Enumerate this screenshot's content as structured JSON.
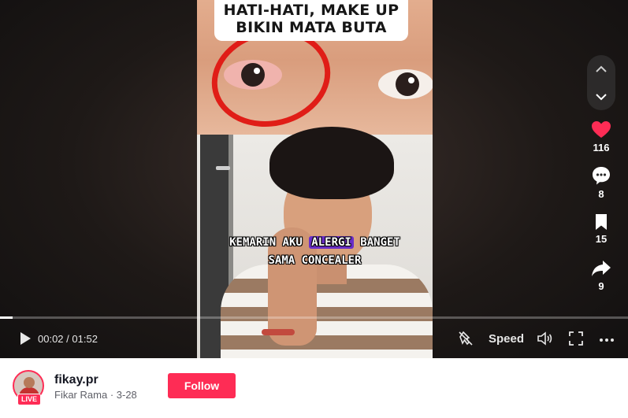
{
  "video": {
    "headline_line1": "HATI-HATI, MAKE UP",
    "headline_line2": "BIKIN MATA BUTA",
    "caption_pre": "KEMARIN AKU ",
    "caption_highlight": "ALERGI",
    "caption_post": " BANGET",
    "caption_line2": "SAMA CONCEALER"
  },
  "actions": {
    "likes": "116",
    "comments": "8",
    "saves": "15",
    "shares": "9"
  },
  "player": {
    "current_time": "00:02",
    "total_time": "01:52",
    "separator": " / ",
    "speed_label": "Speed",
    "progress_fraction": 0.02
  },
  "author": {
    "username": "fikay.pr",
    "display_name": "Fikar Rama",
    "date": "3-28",
    "live_badge": "LIVE",
    "follow_label": "Follow"
  },
  "colors": {
    "accent": "#fe2c55",
    "like": "#fe2c55",
    "highlight": "#6a2ec9",
    "circle": "#e01d17"
  },
  "icons": {
    "play": "play-icon",
    "like": "heart-icon",
    "comment": "comment-icon",
    "save": "bookmark-icon",
    "share": "share-icon",
    "up": "chevron-up-icon",
    "down": "chevron-down-icon",
    "mini": "pin-icon",
    "volume": "volume-icon",
    "fullscreen": "fullscreen-icon",
    "more": "more-icon"
  }
}
